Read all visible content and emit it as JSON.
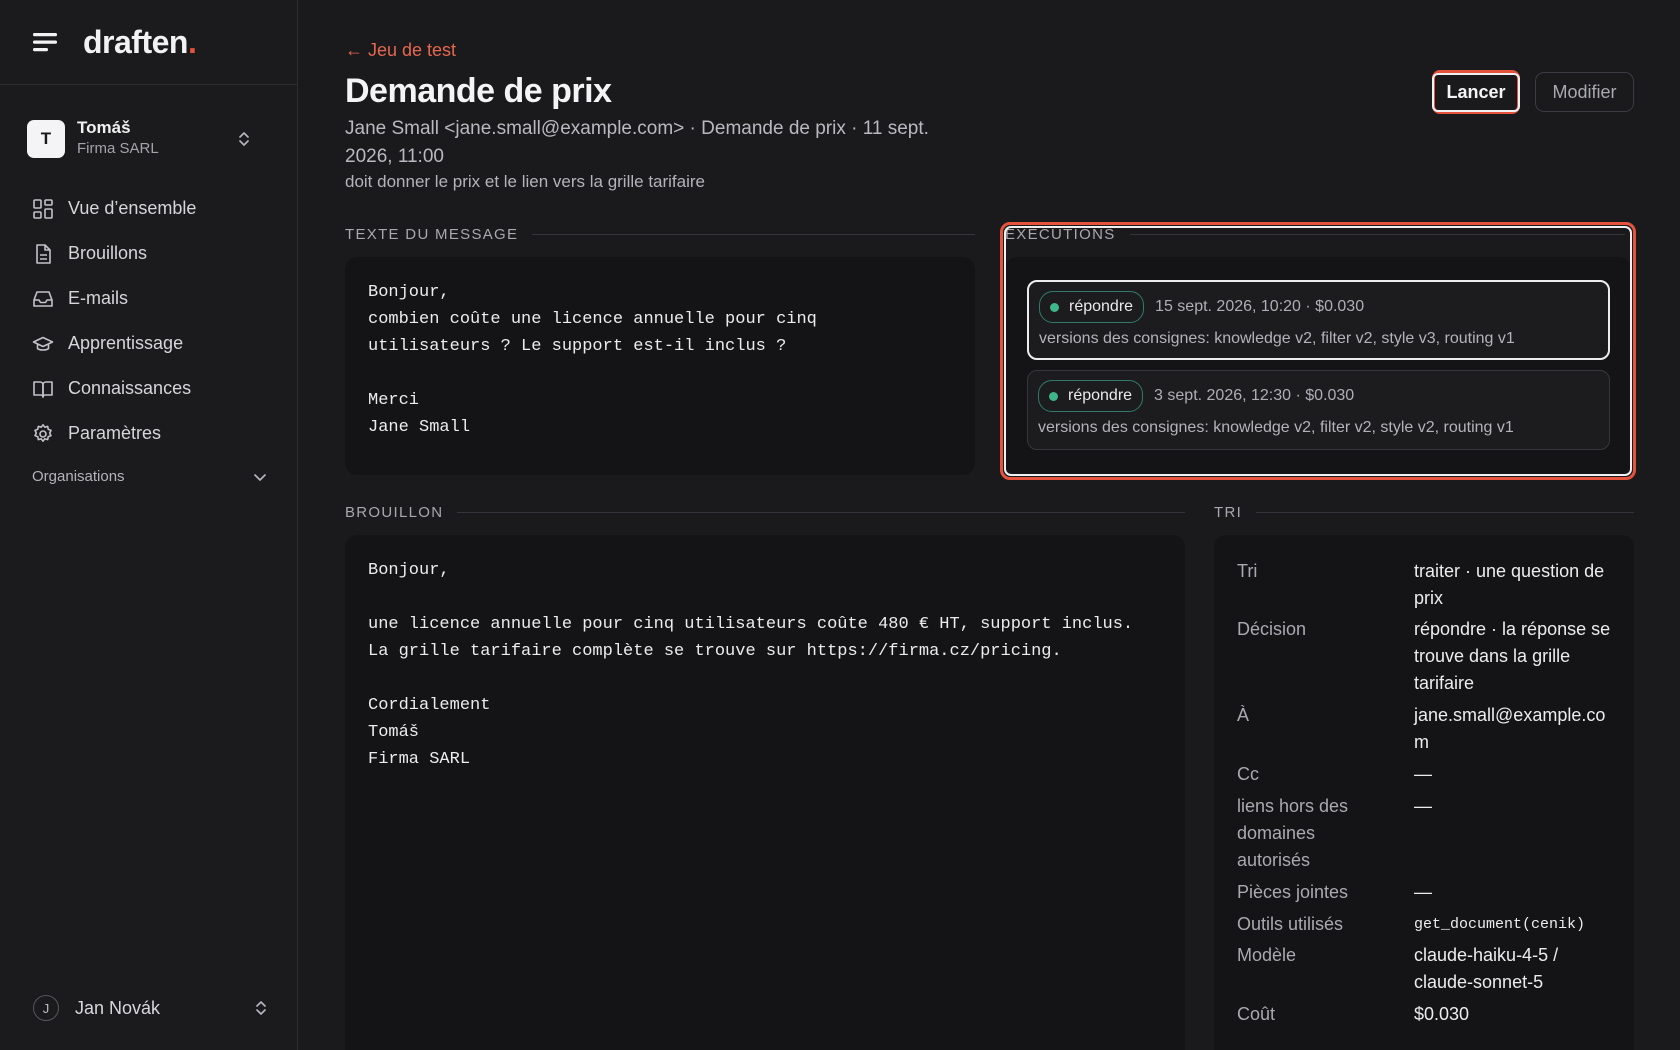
{
  "brand": {
    "logo_text": "draften",
    "logo_dot": "."
  },
  "org": {
    "initial": "T",
    "name": "Tomáš",
    "company": "Firma SARL"
  },
  "nav": [
    {
      "label": "Vue d’ensemble",
      "icon": "grid-icon"
    },
    {
      "label": "Brouillons",
      "icon": "document-icon"
    },
    {
      "label": "E-mails",
      "icon": "inbox-icon"
    },
    {
      "label": "Apprentissage",
      "icon": "graduation-cap-icon"
    },
    {
      "label": "Connaissances",
      "icon": "book-icon"
    },
    {
      "label": "Paramètres",
      "icon": "gear-icon"
    }
  ],
  "organisations_label": "Organisations",
  "user": {
    "initial": "J",
    "name": "Jan Novák"
  },
  "header": {
    "back": "← Jeu de test",
    "title": "Demande de prix",
    "meta": "Jane Small <jane.small@example.com> · Demande de prix · 11 sept. 2026, 11:00",
    "note": "doit donner le prix et le lien vers la grille tarifaire",
    "run_button": "Lancer",
    "edit_button": "Modifier"
  },
  "message": {
    "heading": "TEXTE DU MESSAGE",
    "body": "Bonjour,\ncombien coûte une licence annuelle pour cinq\nutilisateurs ? Le support est-il inclus ?\n\nMerci\nJane Small"
  },
  "executions": {
    "heading": "EXÉCUTIONS",
    "runs": [
      {
        "badge": "répondre",
        "when": "15 sept. 2026, 10:20 · $0.030",
        "versions": "versions des consignes: knowledge v2, filter v2, style v3, routing v1"
      },
      {
        "badge": "répondre",
        "when": "3 sept. 2026, 12:30 · $0.030",
        "versions": "versions des consignes: knowledge v2, filter v2, style v2, routing v1"
      }
    ]
  },
  "draft": {
    "heading": "BROUILLON",
    "body": "Bonjour,\n\nune licence annuelle pour cinq utilisateurs coûte 480 € HT, support inclus.\nLa grille tarifaire complète se trouve sur https://firma.cz/pricing.\n\nCordialement\nTomáš\nFirma SARL"
  },
  "triage": {
    "heading": "TRI",
    "rows": [
      {
        "key": "Tri",
        "value": "traiter · une question de prix"
      },
      {
        "key": "Décision",
        "value": "répondre · la réponse se trouve dans la grille tarifaire"
      },
      {
        "key": "À",
        "value": "jane.small@example.com"
      },
      {
        "key": "Cc",
        "value": "—"
      },
      {
        "key": "liens hors des domaines autorisés",
        "value": "—"
      },
      {
        "key": "Pièces jointes",
        "value": "—"
      },
      {
        "key": "Outils utilisés",
        "value": "get_document(cenik)"
      },
      {
        "key": "Modèle",
        "value": "claude-haiku-4-5 / claude-sonnet-5"
      },
      {
        "key": "Coût",
        "value": "$0.030"
      }
    ]
  },
  "colors": {
    "accent": "#e5533d",
    "success": "#3fb58a",
    "background": "#1a1a1d",
    "panel": "#141416"
  }
}
